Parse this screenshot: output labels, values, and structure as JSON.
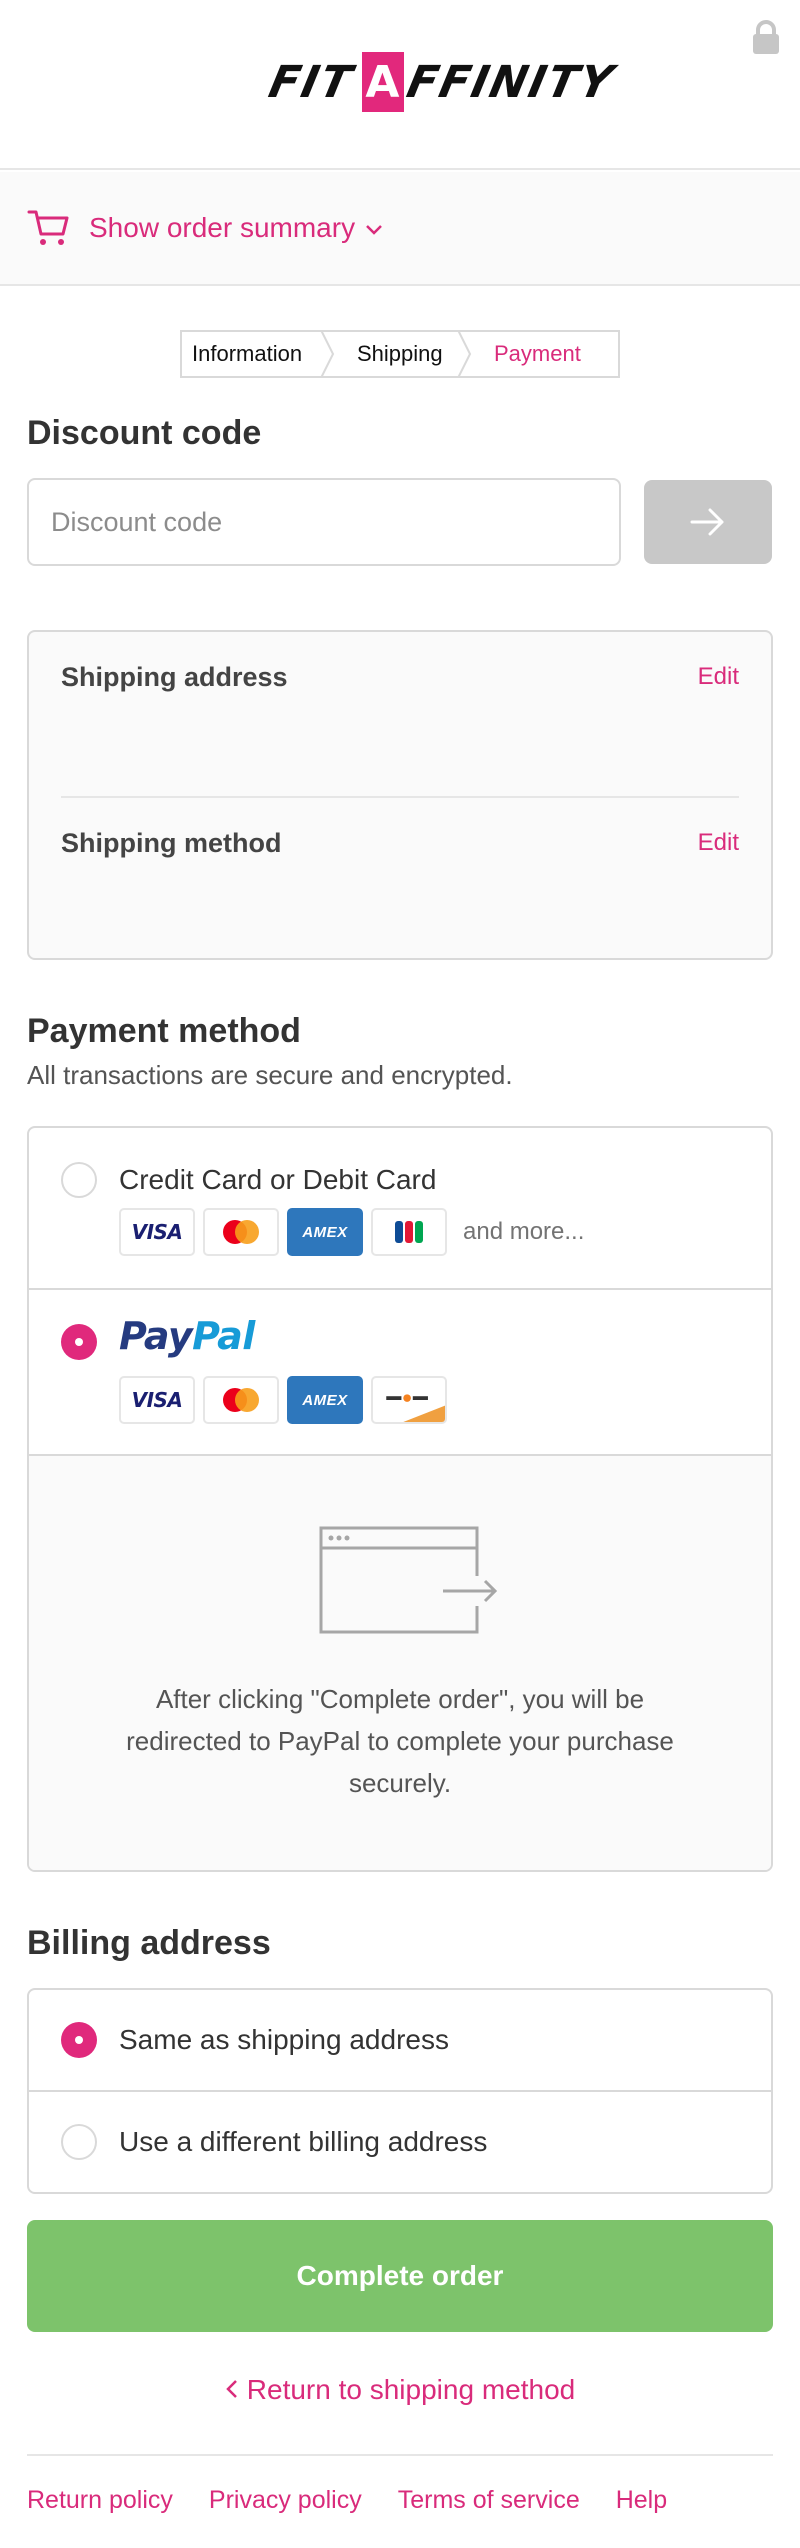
{
  "brand": {
    "logo_left": "FIT",
    "logo_mark": "A",
    "logo_right": "FFINITY",
    "accent": "#e2287c"
  },
  "order_summary": {
    "toggle_label": "Show order summary"
  },
  "breadcrumb": {
    "step1": "Information",
    "step2": "Shipping",
    "step3": "Payment"
  },
  "discount": {
    "title": "Discount code",
    "placeholder": "Discount code"
  },
  "review": {
    "shipping_address_label": "Shipping address",
    "shipping_method_label": "Shipping method",
    "edit_label": "Edit"
  },
  "payment": {
    "title": "Payment method",
    "subtitle": "All transactions are secure and encrypted.",
    "options": [
      {
        "label": "Credit Card or Debit Card",
        "selected": false,
        "cards": [
          "VISA",
          "mastercard",
          "AMEX",
          "JCB"
        ],
        "more": "and more..."
      },
      {
        "label_part1": "Pay",
        "label_part2": "Pal",
        "selected": true,
        "cards": [
          "VISA",
          "mastercard",
          "AMEX",
          "discover"
        ]
      }
    ],
    "visa_text": "VISA",
    "amex_text": "AMEX",
    "redirect_message": "After clicking \"Complete order\", you will be redirected to PayPal to complete your purchase securely."
  },
  "billing": {
    "title": "Billing address",
    "options": [
      {
        "label": "Same as shipping address",
        "selected": true
      },
      {
        "label": "Use a different billing address",
        "selected": false
      }
    ]
  },
  "actions": {
    "complete_label": "Complete order",
    "return_label": "Return to shipping method",
    "complete_color": "#7dc36b"
  },
  "footer": {
    "links": [
      "Return policy",
      "Privacy policy",
      "Terms of service",
      "Help"
    ]
  }
}
